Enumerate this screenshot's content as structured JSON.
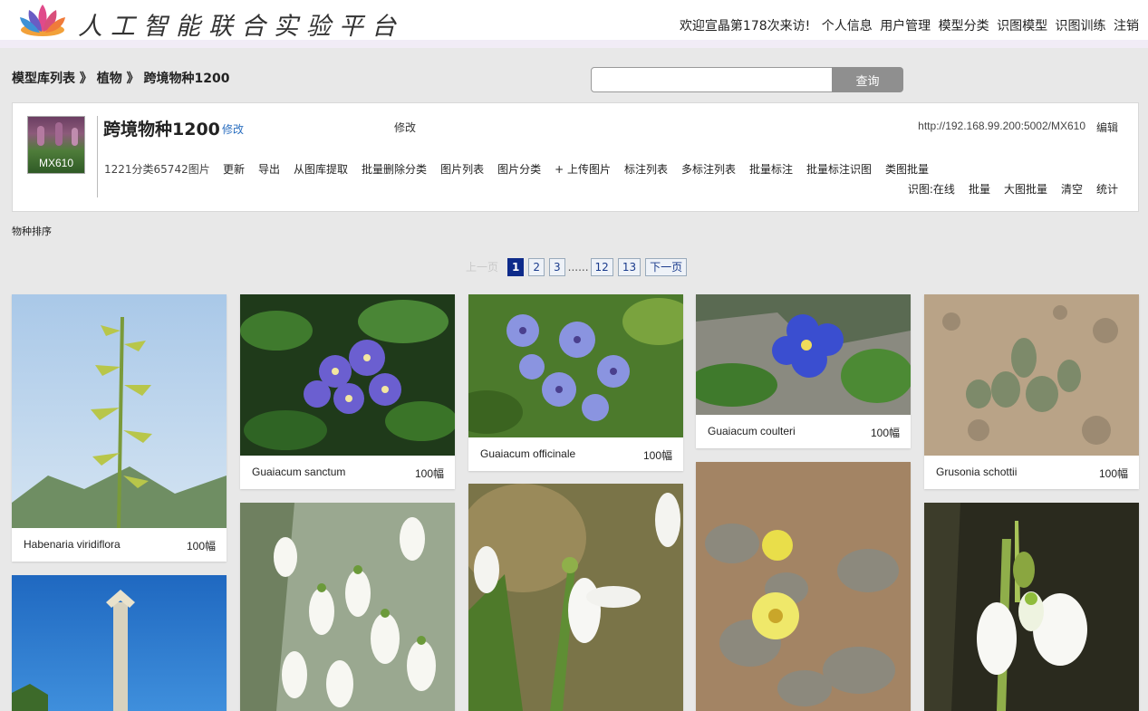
{
  "header": {
    "brand": "人工智能联合实验平台",
    "welcome": "欢迎宣晶第178次来访!",
    "nav": [
      "个人信息",
      "用户管理",
      "模型分类",
      "识图模型",
      "识图训练",
      "注销"
    ]
  },
  "breadcrumb": [
    "模型库列表",
    "植物",
    "跨境物种1200"
  ],
  "breadcrumb_sep": " 》",
  "search": {
    "value": "",
    "button": "查询"
  },
  "model": {
    "thumb_code": "MX610",
    "name": "跨境物种1200",
    "edit_link": "修改",
    "edit_text": "修改",
    "url": "http://192.168.99.200:5002/MX610",
    "url_edit": "编辑",
    "stats": "1221分类65742图片",
    "actions": [
      "更新",
      "导出",
      "从图库提取",
      "批量删除分类",
      "图片列表",
      "图片分类",
      "+ 上传图片",
      "标注列表",
      "多标注列表",
      "批量标注",
      "批量标注识图",
      "类图批量"
    ],
    "recog_label": "识图:",
    "recog_actions": [
      "在线",
      "批量",
      "大图批量",
      "清空",
      "统计"
    ]
  },
  "sort_label": "物种排序",
  "pagination": {
    "prev": "上一页",
    "pages": [
      "1",
      "2",
      "3"
    ],
    "dots": "......",
    "tail": [
      "12",
      "13"
    ],
    "next": "下一页",
    "current": "1"
  },
  "gallery": [
    {
      "name": "Habenaria viridiflora",
      "count": "100幅",
      "icon": "orchid-photo"
    },
    {
      "name": "Guaiacum sanctum",
      "count": "100幅",
      "icon": "purple-flower-photo"
    },
    {
      "name": "Guaiacum officinale",
      "count": "100幅",
      "icon": "blue-flower-photo"
    },
    {
      "name": "Guaiacum coulteri",
      "count": "100幅",
      "icon": "blue-flower-photo"
    },
    {
      "name": "Grusonia schottii",
      "count": "100幅",
      "icon": "cactus-photo"
    },
    {
      "name": "",
      "count": "",
      "icon": "palm-photo"
    },
    {
      "name": "",
      "count": "",
      "icon": "snowdrop-photo"
    },
    {
      "name": "",
      "count": "",
      "icon": "snowdrop-photo"
    },
    {
      "name": "",
      "count": "",
      "icon": "yellow-cactus-photo"
    },
    {
      "name": "",
      "count": "",
      "icon": "snowdrop-photo"
    }
  ]
}
